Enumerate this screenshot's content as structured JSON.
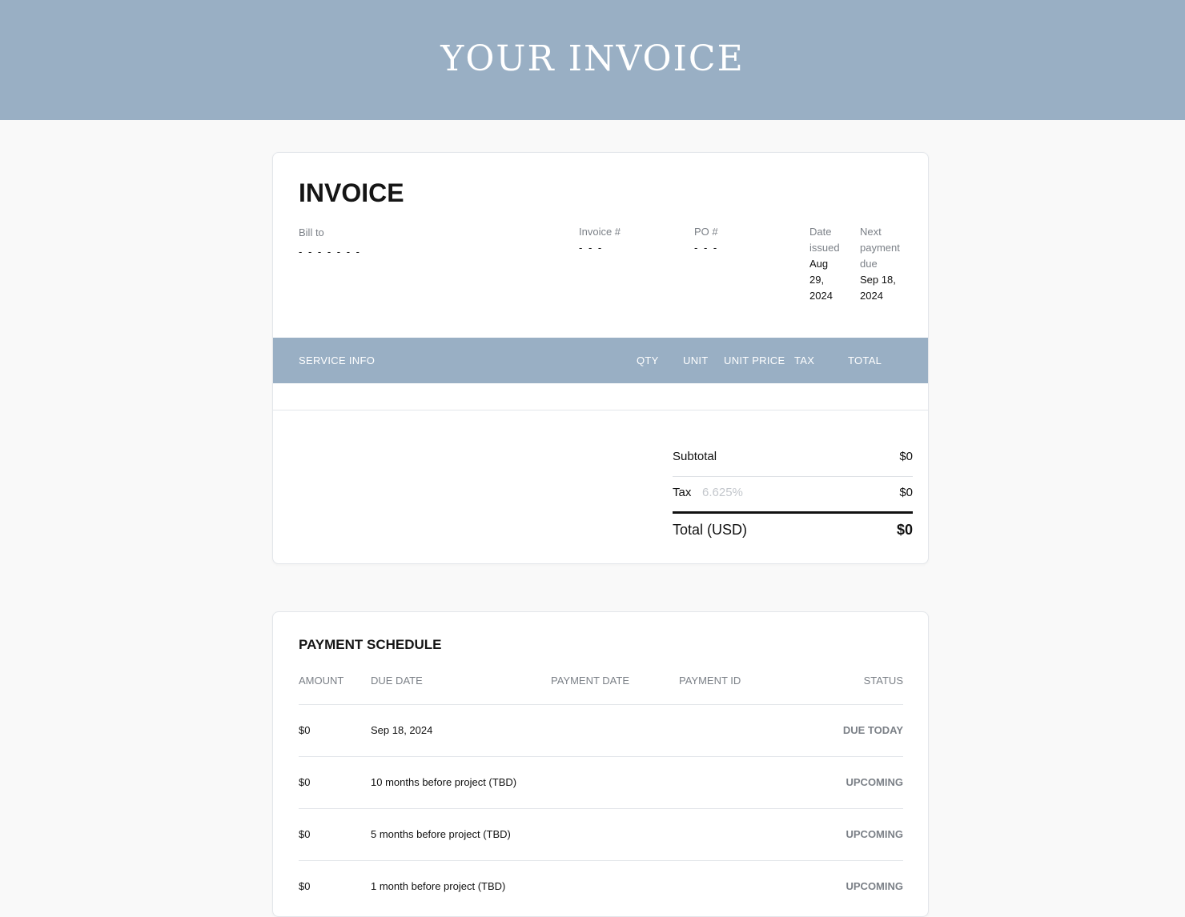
{
  "banner": {
    "title": "YOUR INVOICE"
  },
  "invoice": {
    "heading": "INVOICE",
    "bill_to_label": "Bill to",
    "bill_to_value": "- - - - - - -",
    "invoice_no_label": "Invoice #",
    "invoice_no_value": "- - -",
    "po_label": "PO #",
    "po_value": "- - -",
    "date_issued_label": [
      "Date",
      "issued"
    ],
    "date_issued_value": [
      "Aug",
      "29,",
      "2024"
    ],
    "next_due_label": [
      "Next",
      "payment",
      "due"
    ],
    "next_due_value": [
      "Sep 18,",
      "2024"
    ],
    "table_columns": {
      "service": "SERVICE INFO",
      "qty": "QTY",
      "unit": "UNIT",
      "unit_price": "UNIT PRICE",
      "tax": "TAX",
      "total": "TOTAL"
    },
    "subtotal_label": "Subtotal",
    "subtotal_value": "$0",
    "tax_label": "Tax",
    "tax_rate": "6.625%",
    "tax_value": "$0",
    "total_label": "Total (USD)",
    "total_value": "$0"
  },
  "schedule": {
    "heading": "PAYMENT SCHEDULE",
    "columns": {
      "amount": "AMOUNT",
      "due_date": "DUE DATE",
      "payment_date": "PAYMENT DATE",
      "payment_id": "PAYMENT ID",
      "status": "STATUS"
    },
    "rows": [
      {
        "amount": "$0",
        "due_date": "Sep 18, 2024",
        "status": "DUE TODAY"
      },
      {
        "amount": "$0",
        "due_date": "10 months before project (TBD)",
        "status": "UPCOMING"
      },
      {
        "amount": "$0",
        "due_date": "5 months before project (TBD)",
        "status": "UPCOMING"
      },
      {
        "amount": "$0",
        "due_date": "1 month before project (TBD)",
        "status": "UPCOMING"
      }
    ]
  }
}
